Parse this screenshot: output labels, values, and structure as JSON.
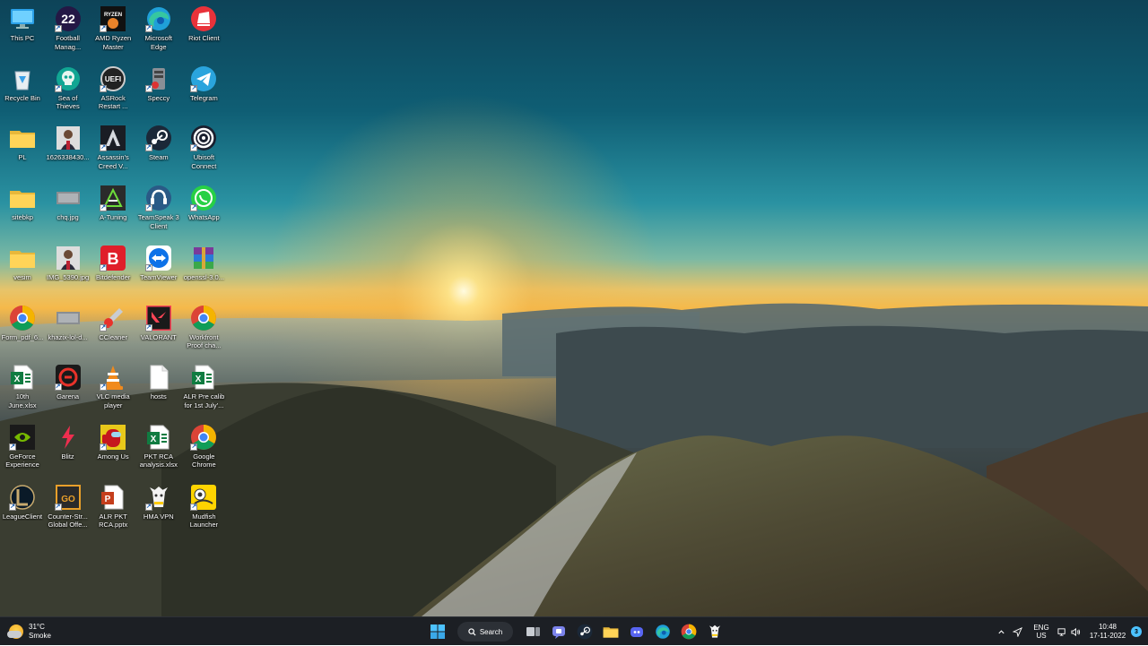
{
  "desktop": {
    "icons": [
      {
        "label": "This PC",
        "icon": "monitor-icon",
        "shortcut": false
      },
      {
        "label": "Football\nManag...",
        "icon": "football-manager-icon",
        "shortcut": true
      },
      {
        "label": "AMD Ryzen\nMaster",
        "icon": "ryzen-master-icon",
        "shortcut": true
      },
      {
        "label": "Microsoft\nEdge",
        "icon": "edge-icon",
        "shortcut": true
      },
      {
        "label": "Riot Client",
        "icon": "riot-client-icon",
        "shortcut": false
      },
      {
        "label": "Recycle Bin",
        "icon": "recycle-bin-icon",
        "shortcut": false
      },
      {
        "label": "Sea of\nThieves",
        "icon": "sea-of-thieves-icon",
        "shortcut": true
      },
      {
        "label": "ASRock\nRestart ...",
        "icon": "uefi-icon",
        "shortcut": true
      },
      {
        "label": "Speccy",
        "icon": "speccy-icon",
        "shortcut": true
      },
      {
        "label": "Telegram",
        "icon": "telegram-icon",
        "shortcut": true
      },
      {
        "label": "PL",
        "icon": "folder-icon",
        "shortcut": false
      },
      {
        "label": "1626338430...",
        "icon": "photo-icon",
        "shortcut": false
      },
      {
        "label": "Assassin's\nCreed V...",
        "icon": "assassins-creed-icon",
        "shortcut": true
      },
      {
        "label": "Steam",
        "icon": "steam-icon",
        "shortcut": true
      },
      {
        "label": "Ubisoft\nConnect",
        "icon": "ubisoft-icon",
        "shortcut": true
      },
      {
        "label": "sitebkp",
        "icon": "folder-icon",
        "shortcut": false
      },
      {
        "label": "chq.jpg",
        "icon": "image-file-icon",
        "shortcut": false
      },
      {
        "label": "A-Tuning",
        "icon": "a-tuning-icon",
        "shortcut": true
      },
      {
        "label": "TeamSpeak 3\nClient",
        "icon": "teamspeak-icon",
        "shortcut": true
      },
      {
        "label": "WhatsApp",
        "icon": "whatsapp-icon",
        "shortcut": true
      },
      {
        "label": "vesim",
        "icon": "folder-icon",
        "shortcut": false
      },
      {
        "label": "IMG_5390.jpg",
        "icon": "photo-icon",
        "shortcut": false
      },
      {
        "label": "Bitdefender",
        "icon": "bitdefender-icon",
        "shortcut": true
      },
      {
        "label": "TeamViewer",
        "icon": "teamviewer-icon",
        "shortcut": true
      },
      {
        "label": "openssl-3.0...",
        "icon": "winrar-archive-icon",
        "shortcut": false
      },
      {
        "label": "Form_pdf_6...",
        "icon": "chrome-icon",
        "shortcut": false
      },
      {
        "label": "khazix-lol-d...",
        "icon": "image-file-icon",
        "shortcut": false
      },
      {
        "label": "CCleaner",
        "icon": "ccleaner-icon",
        "shortcut": true
      },
      {
        "label": "VALORANT",
        "icon": "valorant-icon",
        "shortcut": true
      },
      {
        "label": "Workfront\nProof cha...",
        "icon": "chrome-icon",
        "shortcut": false
      },
      {
        "label": "10th\nJune.xlsx",
        "icon": "excel-icon",
        "shortcut": false
      },
      {
        "label": "Garena",
        "icon": "garena-icon",
        "shortcut": true
      },
      {
        "label": "VLC media\nplayer",
        "icon": "vlc-icon",
        "shortcut": true
      },
      {
        "label": "hosts",
        "icon": "file-icon",
        "shortcut": false
      },
      {
        "label": "ALR Pre calib\nfor 1st July'...",
        "icon": "excel-icon",
        "shortcut": false
      },
      {
        "label": "GeForce\nExperience",
        "icon": "geforce-icon",
        "shortcut": true
      },
      {
        "label": "Blitz",
        "icon": "blitz-icon",
        "shortcut": false
      },
      {
        "label": "Among Us",
        "icon": "among-us-icon",
        "shortcut": true
      },
      {
        "label": "PKT RCA\nanalysis.xlsx",
        "icon": "excel-icon",
        "shortcut": false
      },
      {
        "label": "Google\nChrome",
        "icon": "chrome-icon",
        "shortcut": true
      },
      {
        "label": "LeagueClient",
        "icon": "league-client-icon",
        "shortcut": true
      },
      {
        "label": "Counter-Str...\nGlobal Offe...",
        "icon": "csgo-icon",
        "shortcut": true
      },
      {
        "label": "ALR PKT\nRCA.pptx",
        "icon": "powerpoint-icon",
        "shortcut": false
      },
      {
        "label": "HMA VPN",
        "icon": "hma-vpn-icon",
        "shortcut": true
      },
      {
        "label": "Mudfish\nLauncher",
        "icon": "mudfish-icon",
        "shortcut": true
      }
    ]
  },
  "taskbar": {
    "weather": {
      "temp": "31°C",
      "condition": "Smoke",
      "icon": "weather-sun-haze-icon"
    },
    "start_icon": "windows-start-icon",
    "search_label": "Search",
    "apps": [
      {
        "name": "task-view",
        "icon": "task-view-icon"
      },
      {
        "name": "teams-chat",
        "icon": "teams-chat-icon"
      },
      {
        "name": "steam",
        "icon": "steam-icon"
      },
      {
        "name": "file-explorer",
        "icon": "folder-icon"
      },
      {
        "name": "discord",
        "icon": "discord-icon"
      },
      {
        "name": "edge",
        "icon": "edge-icon"
      },
      {
        "name": "chrome",
        "icon": "chrome-icon"
      },
      {
        "name": "hma-vpn",
        "icon": "hma-vpn-icon"
      }
    ],
    "tray": {
      "lang_line1": "ENG",
      "lang_line2": "US",
      "time": "10:48",
      "date": "17-11-2022",
      "notifications": "3"
    }
  },
  "colors": {
    "taskbar": "#1c1f24",
    "accent": "#4cc2ff"
  }
}
